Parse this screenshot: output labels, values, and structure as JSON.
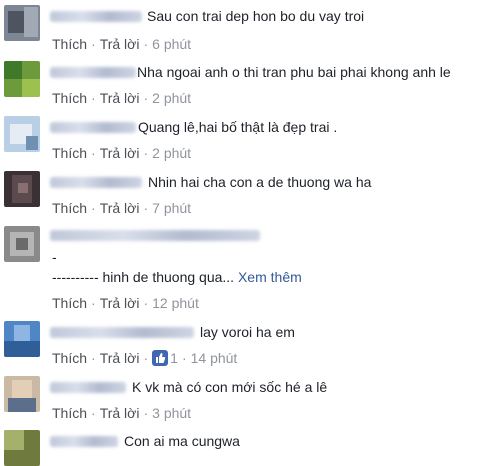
{
  "comments": [
    {
      "text": "Sau con trai dep hon bo du vay troi",
      "like": "Thích",
      "reply": "Trả lời",
      "time": "6 phút"
    },
    {
      "text": "Nha ngoai anh o thi tran phu bai phai khong anh le",
      "like": "Thích",
      "reply": "Trả lời",
      "time": "2 phút"
    },
    {
      "text": "Quang lê,hai bố thật là đẹp trai .",
      "like": "Thích",
      "reply": "Trả lời",
      "time": "2 phút"
    },
    {
      "text": "Nhin hai cha con a de thuong wa ha",
      "like": "Thích",
      "reply": "Trả lời",
      "time": "7 phút"
    },
    {
      "line1": "-",
      "line2": "---------- hinh de thuong qua...",
      "see_more": "Xem thêm",
      "like": "Thích",
      "reply": "Trả lời",
      "time": "12 phút"
    },
    {
      "text": "lay voroi ha em",
      "like": "Thích",
      "reply": "Trả lời",
      "likes_count": "1",
      "time": "14 phút"
    },
    {
      "text": "K vk mà có con mới sốc hé a lê",
      "like": "Thích",
      "reply": "Trả lời",
      "time": "3 phút"
    },
    {
      "text": "Con ai ma cungwa"
    }
  ],
  "colors": {
    "link": "#365899",
    "muted": "#90949c",
    "like_blue": "#4267b2"
  },
  "icons": {
    "like": "thumbs-up-icon"
  }
}
